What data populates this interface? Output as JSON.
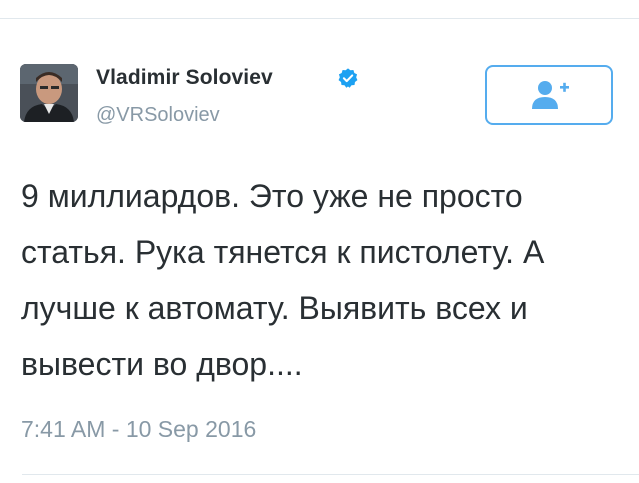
{
  "author": {
    "display_name": "Vladimir Soloviev",
    "handle": "@VRSoloviev",
    "verified": true,
    "avatar_icon": "avatar-photo"
  },
  "follow_button": {
    "icon": "add-user-icon"
  },
  "tweet": {
    "lines": [
      "9 миллиардов. Это уже не просто",
      "статья. Рука тянется к пистолету. А",
      "лучше к автомату. Выявить всех и",
      "вывести во двор...."
    ],
    "timestamp": "7:41 AM - 10 Sep 2016"
  },
  "colors": {
    "accent": "#55acee",
    "verified_badge": "#1da1f2",
    "text": "#292f33",
    "muted": "#8899a6",
    "divider": "#e1e8ed"
  }
}
